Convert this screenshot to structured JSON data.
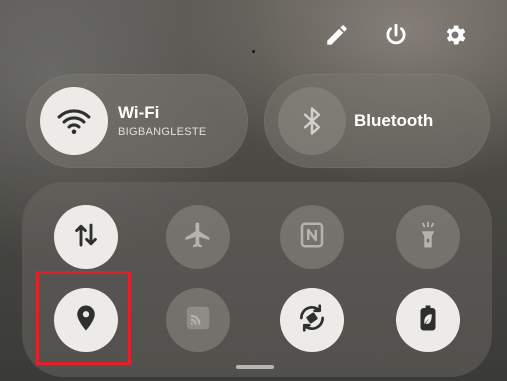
{
  "top_actions": {
    "edit": "pencil-icon",
    "power": "power-icon",
    "settings": "gear-icon"
  },
  "wifi": {
    "title": "Wi-Fi",
    "network": "BIGBANGLESTE",
    "state": "on",
    "icon": "wifi-icon"
  },
  "bluetooth": {
    "title": "Bluetooth",
    "state": "off",
    "icon": "bluetooth-icon"
  },
  "quick_tiles": [
    {
      "icon": "mobile-data-icon",
      "state": "on"
    },
    {
      "icon": "airplane-icon",
      "state": "off"
    },
    {
      "icon": "nfc-icon",
      "state": "off"
    },
    {
      "icon": "flashlight-icon",
      "state": "off"
    },
    {
      "icon": "location-icon",
      "state": "on",
      "highlighted": true
    },
    {
      "icon": "cast-icon",
      "state": "off"
    },
    {
      "icon": "auto-rotate-icon",
      "state": "on"
    },
    {
      "icon": "battery-saver-icon",
      "state": "on"
    }
  ],
  "colors": {
    "tile_on": "#ecebe7",
    "tile_off_icon": "#a9a7a1",
    "highlight": "#e0212b"
  }
}
